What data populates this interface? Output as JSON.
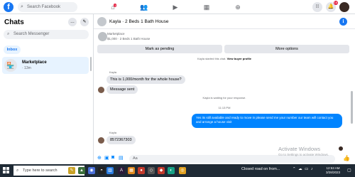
{
  "topbar": {
    "logo": "f",
    "search_placeholder": "Search Facebook",
    "nav_badge": "1",
    "notifications_badge": "16"
  },
  "sidebar": {
    "title": "Chats",
    "more_icon": "…",
    "compose_icon": "✎",
    "search_placeholder": "Search Messenger",
    "inbox_tab": "Inbox",
    "conversation": {
      "title": "Marketplace",
      "time": "· 13m"
    }
  },
  "chat": {
    "title": "Kayla · 2 Beds 1 Bath House",
    "marketplace_label": "Marketplace",
    "listing": "$1,000 · 2 Beds 1 Bath House",
    "mark_pending": "Mark as pending",
    "more_options": "More options",
    "started_text": "Kayla started this chat.",
    "view_profile": "View buyer profile",
    "sender_1": "Kayla",
    "message_1": "This is 1,000/month for the whole house?",
    "message_2": "Message sent",
    "waiting_text": "Kayla is waiting for your response.",
    "timestamp": "11:13 PM",
    "outgoing_message": "Yes its still available and ready to move in please send me your number our team will contact you and arrange a  house visit",
    "sender_2": "Kayla",
    "message_3": "8572367303",
    "composer_placeholder": "Aa"
  },
  "watermark": {
    "line1": "Activate Windows",
    "line2": "Go to Settings to activate Windows."
  },
  "taskbar": {
    "search_placeholder": "Type here to search",
    "weather": "Closed road on from...",
    "time": "12:53 AM",
    "date": "3/28/2023"
  }
}
